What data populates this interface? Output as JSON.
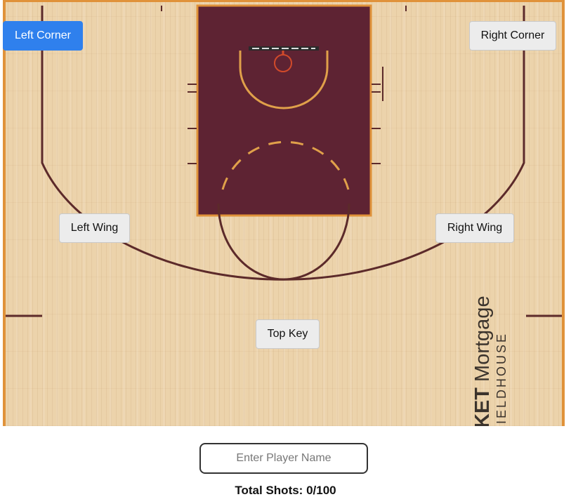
{
  "court": {
    "colors": {
      "wood": "#ecd3ab",
      "paint": "#5e2333",
      "line": "#5c2a2a",
      "border": "#e0923a",
      "accent": "#e0a04a"
    },
    "brand_lines": {
      "bold": "KET",
      "main": " Mortgage",
      "sub": "IELDHOUSE"
    }
  },
  "zones": {
    "left_corner": "Left Corner",
    "right_corner": "Right Corner",
    "left_wing": "Left Wing",
    "right_wing": "Right Wing",
    "top_key": "Top Key",
    "selected": "Left Corner"
  },
  "player": {
    "placeholder": "Enter Player Name",
    "value": ""
  },
  "stats": {
    "total_label": "Total Shots: 0/100",
    "shots_taken": 0,
    "shots_max": 100
  }
}
